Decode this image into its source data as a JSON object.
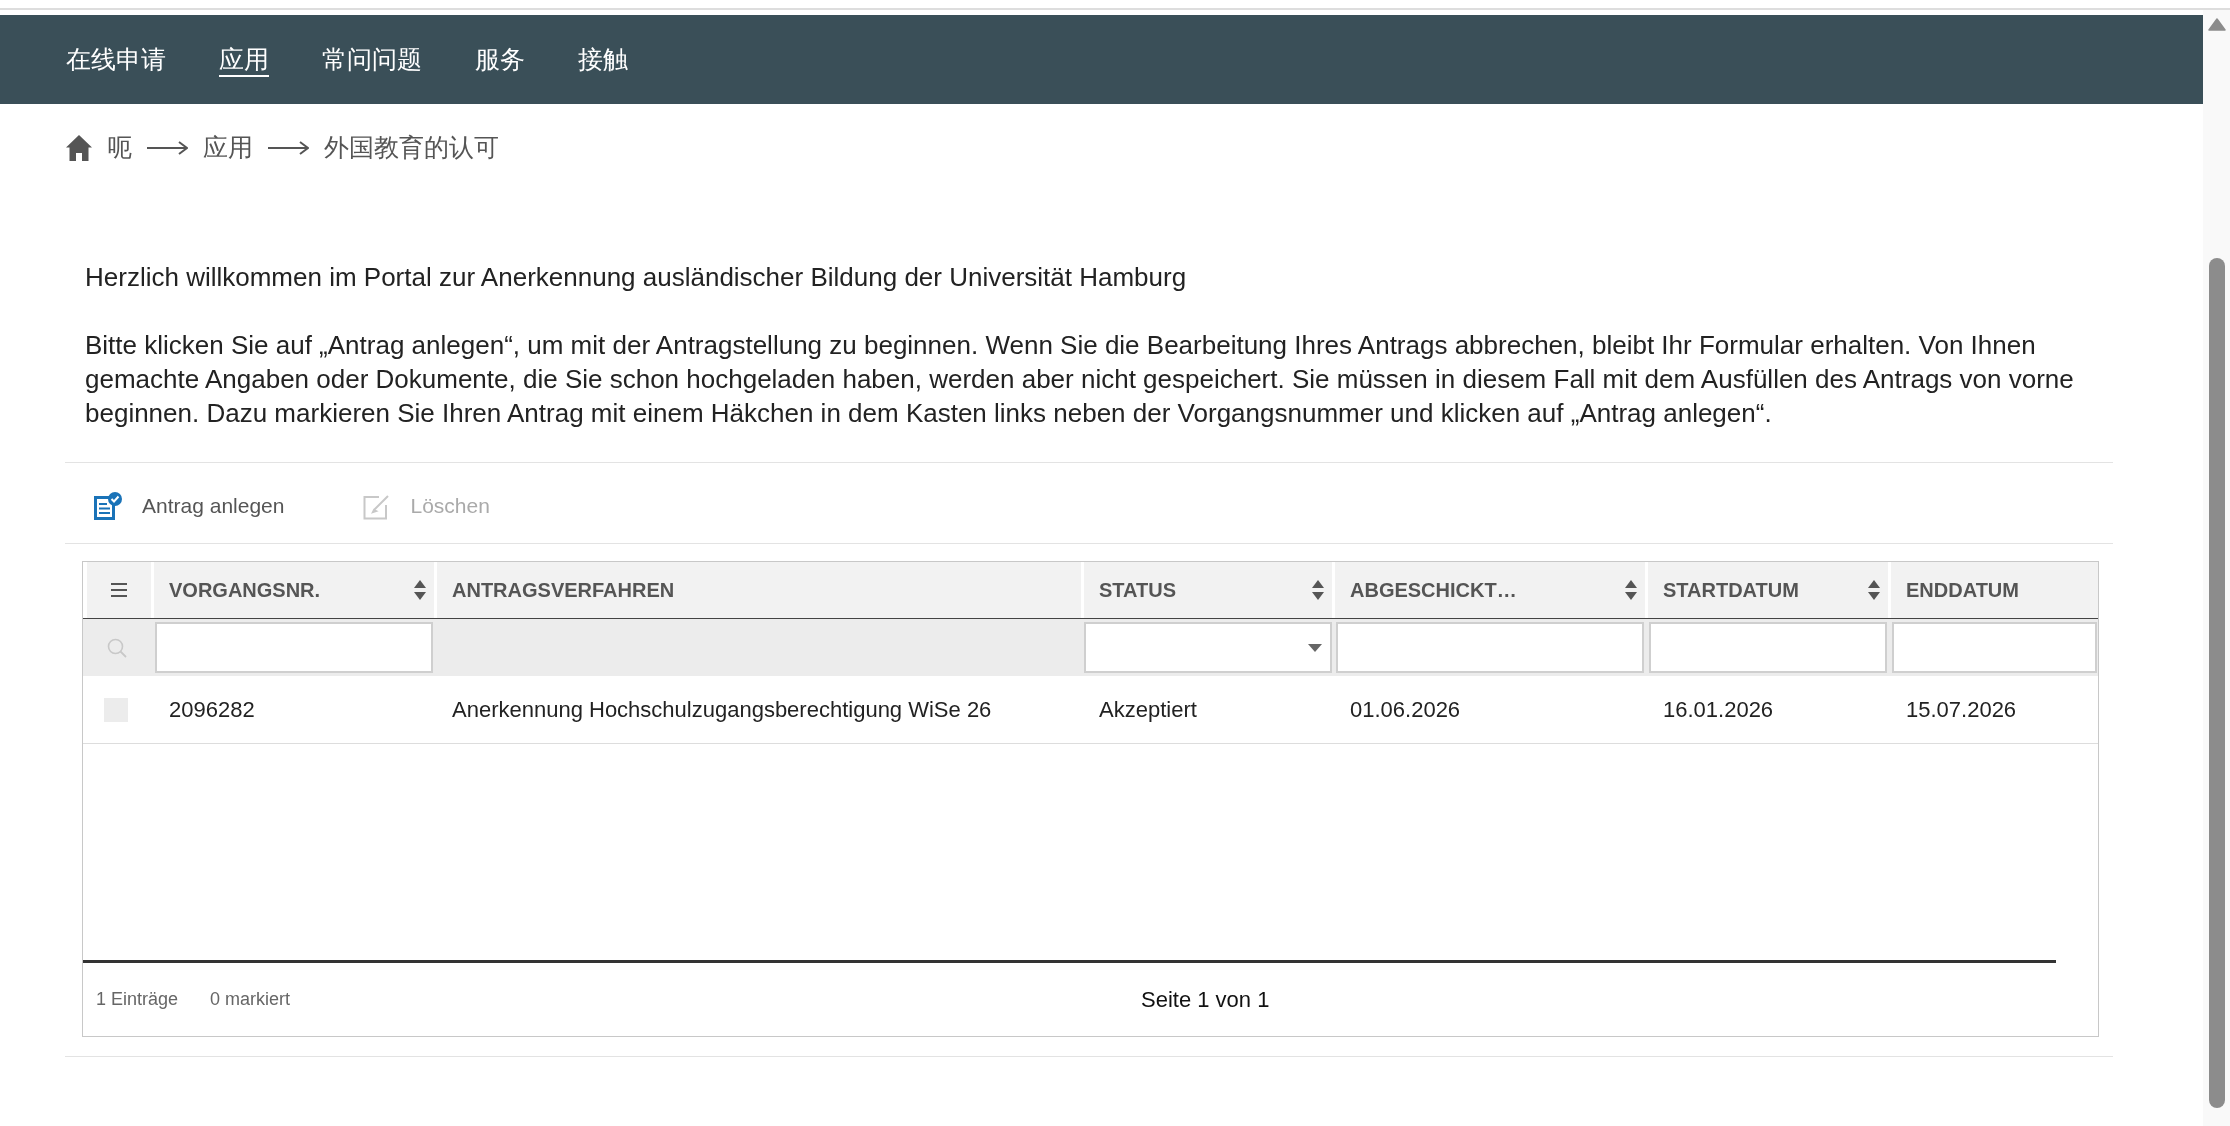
{
  "nav": {
    "items": [
      {
        "label": "在线申请",
        "selected": false
      },
      {
        "label": "应用",
        "selected": true
      },
      {
        "label": "常问问题",
        "selected": false
      },
      {
        "label": "服务",
        "selected": false
      },
      {
        "label": "接触",
        "selected": false
      }
    ]
  },
  "breadcrumb": {
    "items": [
      "呃",
      "应用",
      "外国教育的认可"
    ]
  },
  "intro": {
    "title": "Herzlich willkommen im Portal zur Anerkennung ausländischer Bildung der Universität Hamburg",
    "text": "Bitte klicken Sie auf „Antrag anlegen“, um mit der Antragstellung zu beginnen. Wenn Sie die Bearbeitung Ihres Antrags abbrechen, bleibt Ihr Formular erhalten. Von Ihnen gemachte Angaben oder Dokumente, die Sie schon hochgeladen haben, werden aber nicht gespeichert. Sie müssen in diesem Fall mit dem Ausfüllen des Antrags von vorne beginnen. Dazu markieren Sie Ihren Antrag mit einem Häkchen in dem Kasten links neben der Vorgangsnummer und klicken auf „Antrag anlegen“."
  },
  "toolbar": {
    "buttons": [
      {
        "label": "Antrag anlegen",
        "kind": "create",
        "disabled": false
      },
      {
        "label": "Löschen",
        "kind": "edit",
        "disabled": true
      }
    ]
  },
  "table": {
    "columns": [
      {
        "label": "VORGANGSNR.",
        "sortable": true,
        "kind": "text"
      },
      {
        "label": "ANTRAGSVERFAHREN",
        "sortable": false,
        "kind": "none"
      },
      {
        "label": "STATUS",
        "sortable": true,
        "kind": "select"
      },
      {
        "label": "ABGESCHICKT…",
        "sortable": true,
        "kind": "text"
      },
      {
        "label": "STARTDATUM",
        "sortable": true,
        "kind": "text"
      },
      {
        "label": "ENDDATUM",
        "sortable": false,
        "kind": "text"
      }
    ],
    "rows": [
      {
        "selected": false,
        "cells": [
          "2096282",
          "Anerkennung Hochschulzugangsberechtigung WiSe 26",
          "Akzeptiert",
          "01.06.2026",
          "16.01.2026",
          "15.07.2026"
        ]
      }
    ],
    "footer": {
      "count": "1 Einträge",
      "marked": "0 markiert",
      "pages": "Seite 1 von 1"
    }
  }
}
